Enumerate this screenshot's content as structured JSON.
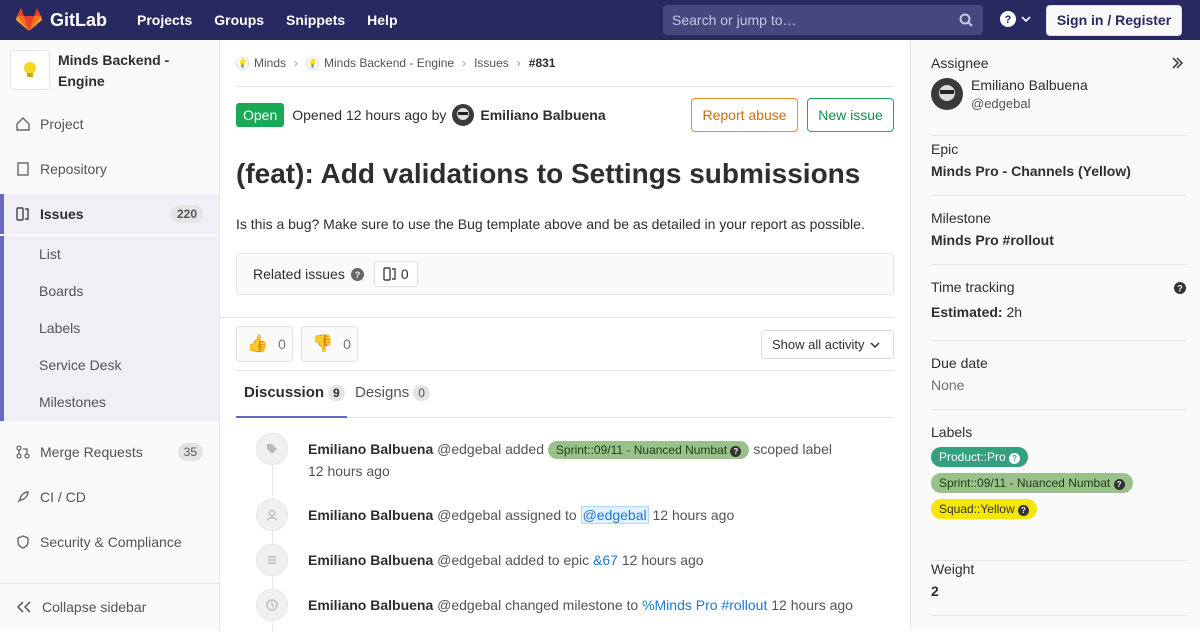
{
  "topbar": {
    "brand": "GitLab",
    "nav": [
      "Projects",
      "Groups",
      "Snippets",
      "Help"
    ],
    "search_placeholder": "Search or jump to…",
    "signin": "Sign in / Register"
  },
  "sidebar": {
    "project_name_1": "Minds Backend -",
    "project_name_2": "Engine",
    "items": [
      {
        "label": "Project"
      },
      {
        "label": "Repository"
      },
      {
        "label": "Issues",
        "count": "220"
      },
      {
        "label": "Merge Requests",
        "count": "35"
      },
      {
        "label": "CI / CD"
      },
      {
        "label": "Security & Compliance"
      }
    ],
    "sub": [
      "List",
      "Boards",
      "Labels",
      "Service Desk",
      "Milestones"
    ],
    "collapse": "Collapse sidebar"
  },
  "breadcrumb": {
    "b1": "Minds",
    "b2": "Minds Backend - Engine",
    "b3": "Issues",
    "b4": "#831"
  },
  "issue": {
    "status": "Open",
    "opened": "Opened 12 hours ago by",
    "author": "Emiliano Balbuena",
    "report": "Report abuse",
    "new": "New issue",
    "title": "(feat): Add validations to Settings submissions",
    "description": "Is this a bug? Make sure to use the Bug template above and be as detailed in your report as possible.",
    "related": "Related issues",
    "related_count": "0",
    "thumbs_up": "0",
    "thumbs_down": "0",
    "show_all": "Show all activity"
  },
  "tabs": {
    "discussion": "Discussion",
    "discussion_count": "9",
    "designs": "Designs",
    "designs_count": "0"
  },
  "events": [
    {
      "name": "Emiliano Balbuena",
      "handle": "@edgebal",
      "action": "added",
      "label": "Sprint::09/11 - Nuanced Numbat",
      "after": "scoped label",
      "time": "12 hours ago"
    },
    {
      "name": "Emiliano Balbuena",
      "handle": "@edgebal",
      "action": "assigned to",
      "link": "@edgebal",
      "time": "12 hours ago"
    },
    {
      "name": "Emiliano Balbuena",
      "handle": "@edgebal",
      "action": "added to epic",
      "link": "&67",
      "time": "12 hours ago"
    },
    {
      "name": "Emiliano Balbuena",
      "handle": "@edgebal",
      "action": "changed milestone to",
      "link": "%Minds Pro #rollout",
      "time": "12 hours ago"
    }
  ],
  "right": {
    "assignee_h": "Assignee",
    "assignee_name": "Emiliano Balbuena",
    "assignee_handle": "@edgebal",
    "epic_h": "Epic",
    "epic": "Minds Pro - Channels (Yellow)",
    "milestone_h": "Milestone",
    "milestone": "Minds Pro #rollout",
    "time_h": "Time tracking",
    "estimated_k": "Estimated:",
    "estimated_v": "2h",
    "due_h": "Due date",
    "due": "None",
    "labels_h": "Labels",
    "labels": [
      "Product::Pro",
      "Sprint::09/11 - Nuanced Numbat",
      "Squad::Yellow"
    ],
    "weight_h": "Weight",
    "weight": "2"
  },
  "colors": {
    "topbar": "#292961",
    "open": "#1aaa55",
    "pro": "#33a17e",
    "sprint": "#9ac18a",
    "squad": "#f5e50b"
  }
}
